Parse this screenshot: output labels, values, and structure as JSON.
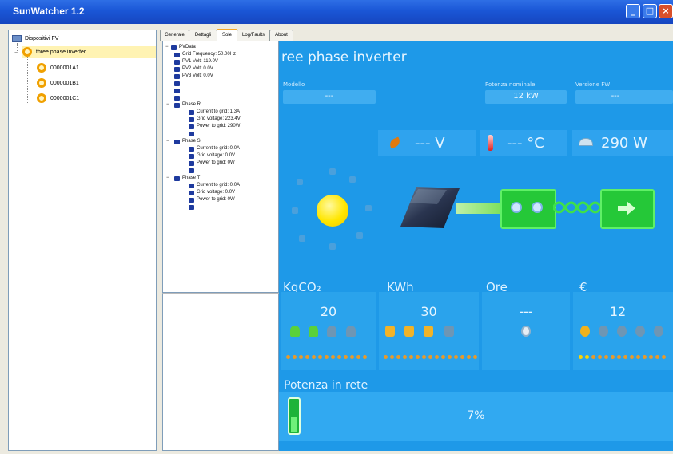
{
  "window": {
    "title": "SunWatcher 1.2"
  },
  "devices_tree": {
    "root": "Dispositivi FV",
    "selected": "three phase inverter",
    "children": [
      "0000001A1",
      "0000001B1",
      "0000001C1"
    ]
  },
  "tabs": [
    {
      "label": "Generale",
      "active": false
    },
    {
      "label": "Dettagli",
      "active": false
    },
    {
      "label": "Sole",
      "active": true
    },
    {
      "label": "Log/Faults",
      "active": false
    },
    {
      "label": "About",
      "active": false
    }
  ],
  "pv_tree": {
    "root": "PVData",
    "grid_items": [
      "Grid Frequency: 50.00Hz",
      "PV1 Volt: 119.0V",
      "PV2 Volt: 0.0V",
      "PV3 Volt: 0.0V"
    ],
    "phases": [
      {
        "name": "Phase R",
        "items": [
          "Current to grid: 1.3A",
          "Grid voltage: 223.4V",
          "Power to grid: 290W"
        ]
      },
      {
        "name": "Phase S",
        "items": [
          "Current to grid: 0.0A",
          "Grid voltage: 0.0V",
          "Power to grid: 0W"
        ]
      },
      {
        "name": "Phase T",
        "items": [
          "Current to grid: 0.0A",
          "Grid voltage: 0.0V",
          "Power to grid: 0W"
        ]
      }
    ]
  },
  "dashboard": {
    "title": "ree phase inverter",
    "model": {
      "label": "Modello",
      "value": "---"
    },
    "nominal_power": {
      "label": "Potenza nominale",
      "value": "12 kW"
    },
    "fw_version": {
      "label": "Versione FW",
      "value": "---"
    },
    "voltage": {
      "value": "--- V"
    },
    "temperature": {
      "value": "--- °C"
    },
    "power": {
      "value": "290 W"
    },
    "co2": {
      "label": "KgCO₂",
      "value": "20"
    },
    "energy": {
      "label": "KWh",
      "value": "30"
    },
    "hours": {
      "label": "Ore",
      "value": "---"
    },
    "money": {
      "label": "€",
      "value": "12"
    },
    "grid_power": {
      "label": "Potenza in rete",
      "value": "7%",
      "fraction": 0.07
    }
  },
  "colors": {
    "titlebar": "#1a56d6",
    "dashboard_bg": "#1e99e8",
    "green_box": "#25c838",
    "sun": "#ffe600",
    "node_orange": "#f0a000"
  }
}
